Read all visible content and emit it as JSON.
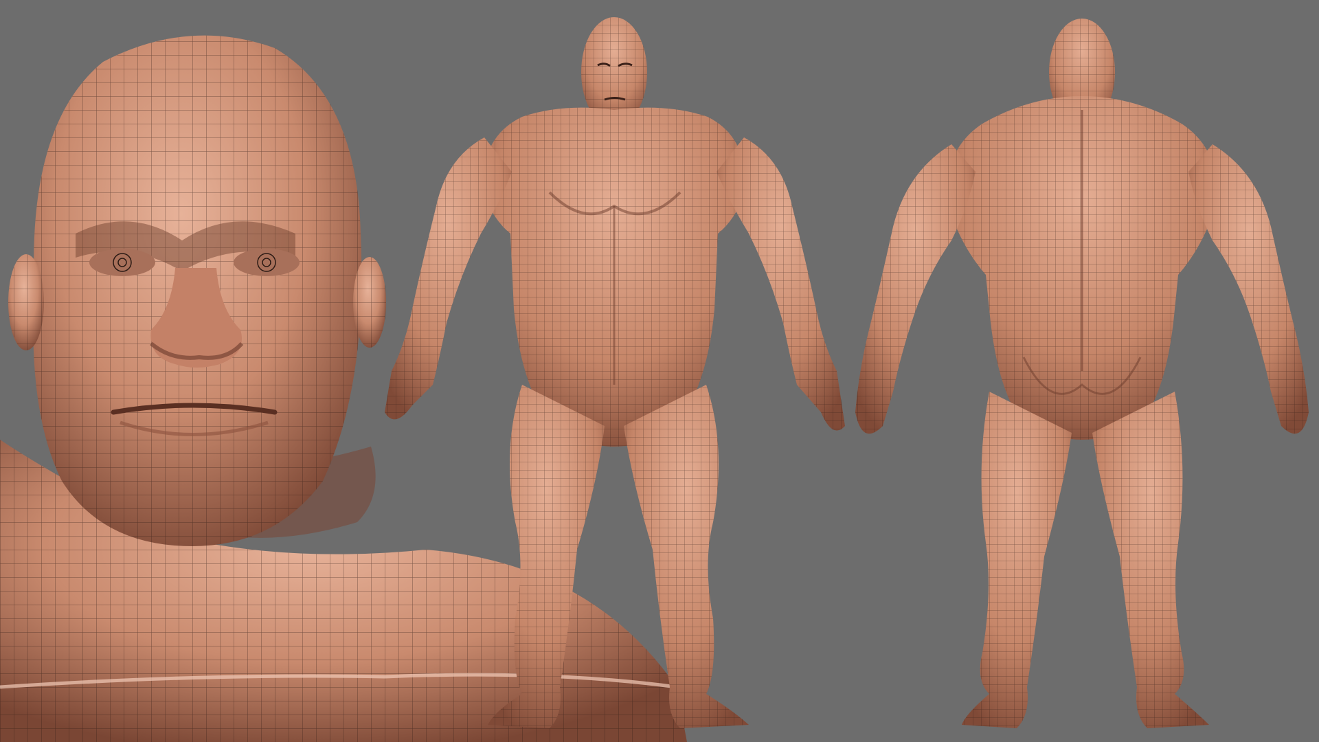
{
  "scene": {
    "background_color": "#6d6d6d",
    "skin_base_color": "#c98a6e",
    "skin_highlight_color": "#e7b299",
    "skin_shadow_color": "#7a4634",
    "wire_color": "#2b1a14",
    "panels": [
      {
        "view": "head-closeup",
        "icon": "head-icon"
      },
      {
        "view": "body-front",
        "icon": "figure-front-icon"
      },
      {
        "view": "body-back",
        "icon": "figure-back-icon"
      }
    ]
  }
}
